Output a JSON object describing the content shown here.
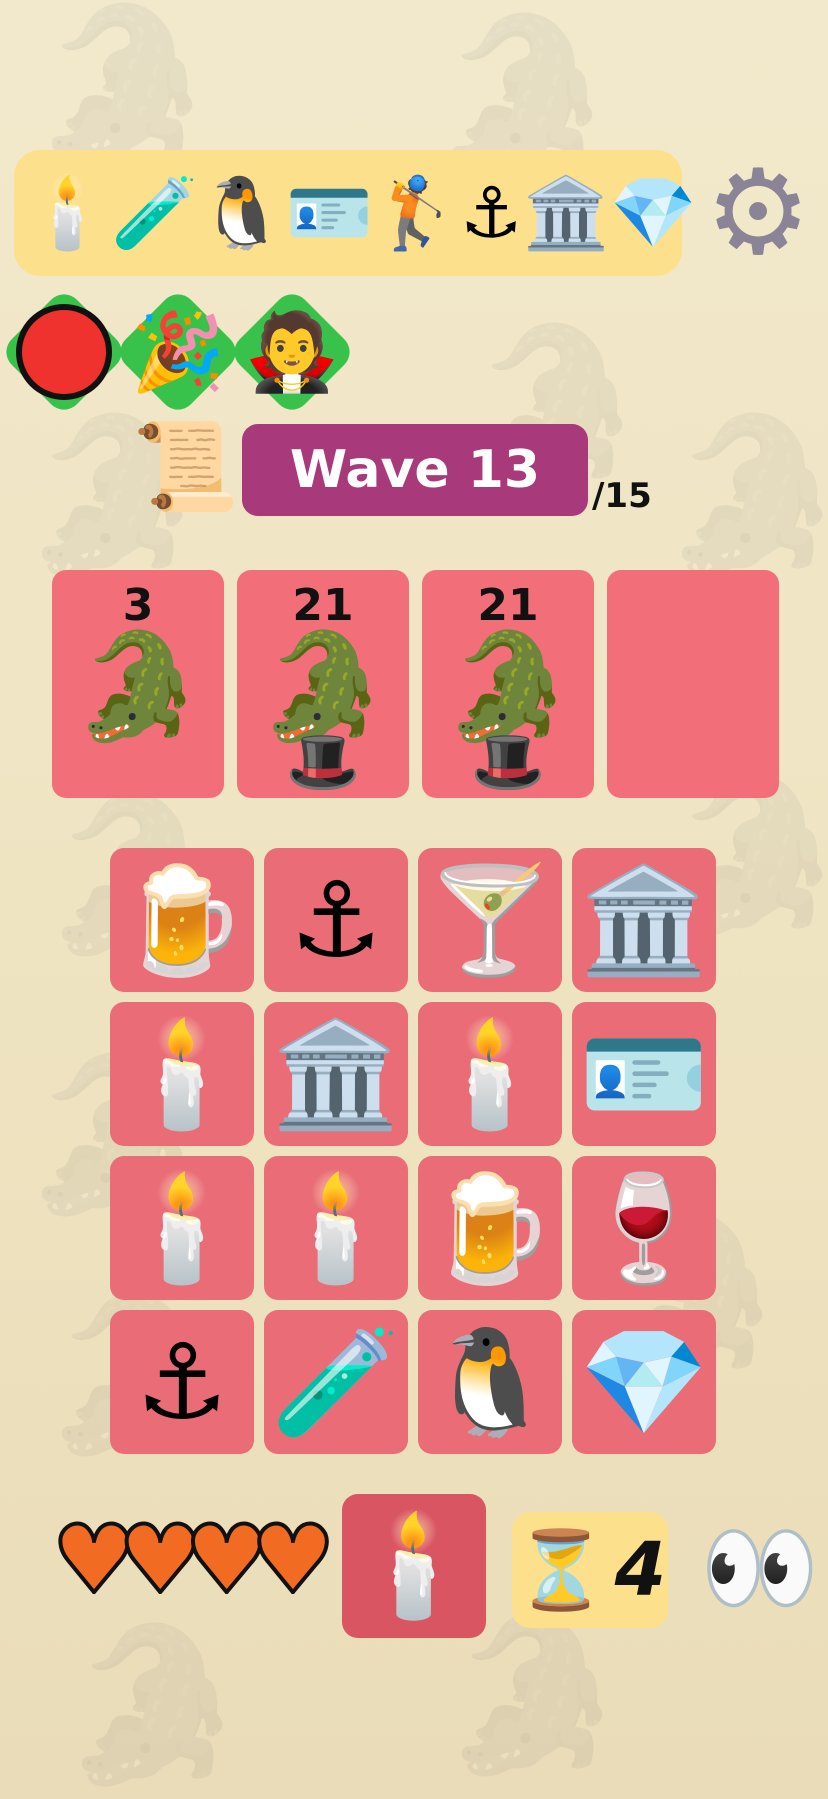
{
  "inventory": {
    "items": [
      {
        "name": "candle-icon",
        "glyph": "🕯️"
      },
      {
        "name": "test-tube-icon",
        "glyph": "🧪"
      },
      {
        "name": "penguin-icon",
        "glyph": "🐧"
      },
      {
        "name": "rainbow-card-icon",
        "glyph": "🪪"
      },
      {
        "name": "golfer-icon",
        "glyph": "🏌️"
      },
      {
        "name": "anchor-icon",
        "glyph": "⚓"
      },
      {
        "name": "classical-building-icon",
        "glyph": "🏛️"
      },
      {
        "name": "gem-icon",
        "glyph": "💎"
      }
    ],
    "settings_glyph": "⚙"
  },
  "effects": [
    {
      "name": "red-circle-icon",
      "glyph": ""
    },
    {
      "name": "party-popper-icon",
      "glyph": "🎉"
    },
    {
      "name": "rainbow-person-icon",
      "glyph": "🧛"
    }
  ],
  "wave": {
    "scroll_glyph": "📜",
    "label": "Wave 13",
    "total": "/15"
  },
  "enemies": [
    {
      "hp": "3",
      "sprite": "🐊",
      "hat": ""
    },
    {
      "hp": "21",
      "sprite": "🐊",
      "hat": "🎩"
    },
    {
      "hp": "21",
      "sprite": "🐊",
      "hat": "🎩"
    },
    {
      "hp": "",
      "sprite": "",
      "hat": ""
    }
  ],
  "grid": [
    {
      "name": "beer-mug-icon",
      "glyph": "🍺"
    },
    {
      "name": "anchor-icon",
      "glyph": "⚓"
    },
    {
      "name": "cocktail-icon",
      "glyph": "🍸"
    },
    {
      "name": "classical-building-icon",
      "glyph": "🏛️"
    },
    {
      "name": "candle-icon",
      "glyph": "🕯️"
    },
    {
      "name": "classical-building-icon",
      "glyph": "🏛️"
    },
    {
      "name": "candle-icon",
      "glyph": "🕯️"
    },
    {
      "name": "rainbow-card-icon",
      "glyph": "🪪"
    },
    {
      "name": "candle-icon",
      "glyph": "🕯️"
    },
    {
      "name": "candle-icon",
      "glyph": "🕯️"
    },
    {
      "name": "beer-mug-icon",
      "glyph": "🍺"
    },
    {
      "name": "wine-glass-icon",
      "glyph": "🍷"
    },
    {
      "name": "anchor-icon",
      "glyph": "⚓"
    },
    {
      "name": "test-tube-icon",
      "glyph": "🧪"
    },
    {
      "name": "penguin-icon",
      "glyph": "🐧"
    },
    {
      "name": "gem-icon",
      "glyph": "💎"
    }
  ],
  "status": {
    "hearts": 4,
    "heart_glyph": "♥",
    "current_item_glyph": "🕯️",
    "hourglass_glyph": "⏳",
    "timer_value": "4",
    "eyes_glyph": "👀"
  },
  "colors": {
    "card_red": "#f26f7a",
    "grid_red": "#ea6c76",
    "wave_magenta": "#a8397a",
    "panel_yellow": "#fde08c",
    "heart_orange": "#f26b22",
    "effect_green": "#38c24c"
  }
}
